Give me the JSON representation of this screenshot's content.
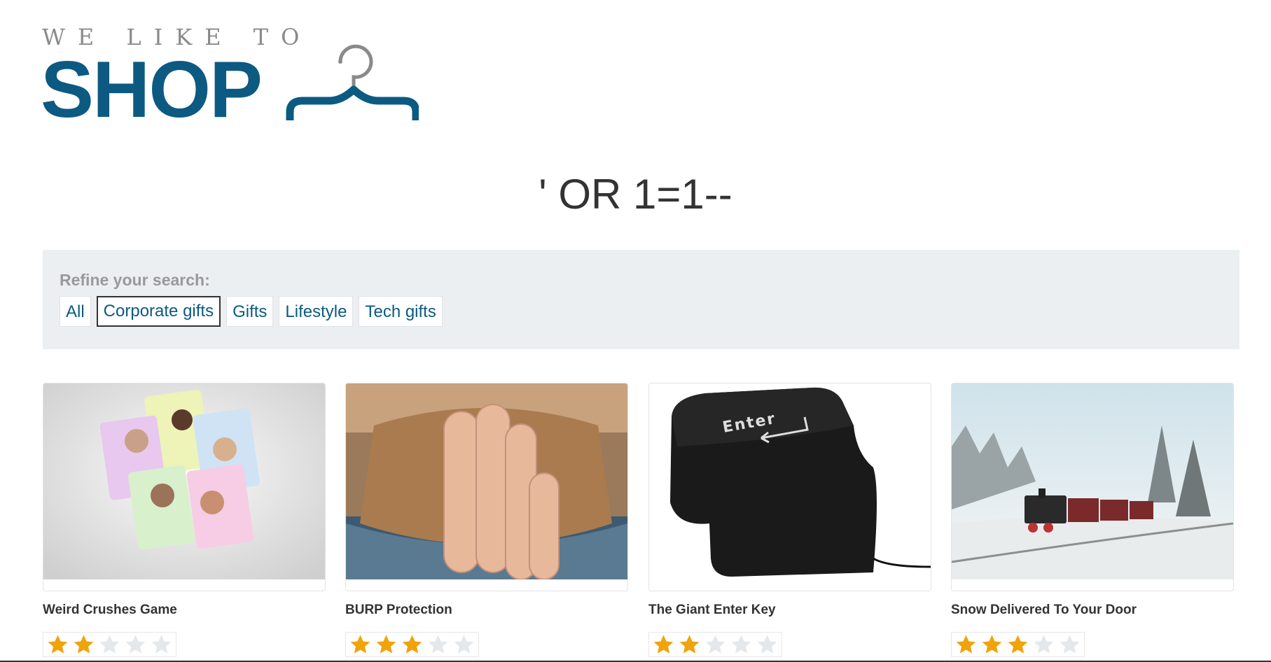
{
  "logo": {
    "top_text": "WE LIKE TO",
    "main_text": "SHOP",
    "icon": "hanger-icon"
  },
  "search": {
    "heading": "' OR 1=1--"
  },
  "filter": {
    "label": "Refine your search:",
    "categories": [
      {
        "label": "All",
        "active": false
      },
      {
        "label": "Corporate gifts",
        "active": true
      },
      {
        "label": "Gifts",
        "active": false
      },
      {
        "label": "Lifestyle",
        "active": false
      },
      {
        "label": "Tech gifts",
        "active": false
      }
    ]
  },
  "products": [
    {
      "title": "Weird Crushes Game",
      "rating": 2,
      "max_rating": 5
    },
    {
      "title": "BURP Protection",
      "rating": 3,
      "max_rating": 5
    },
    {
      "title": "The Giant Enter Key",
      "rating": 2,
      "max_rating": 5,
      "image_text": "Enter"
    },
    {
      "title": "Snow Delivered To Your Door",
      "rating": 3,
      "max_rating": 5
    }
  ],
  "colors": {
    "brand": "#0c5a82",
    "star_on": "#f0a30a",
    "star_off": "#e5e8ea",
    "filter_bg": "#ebeff2"
  }
}
